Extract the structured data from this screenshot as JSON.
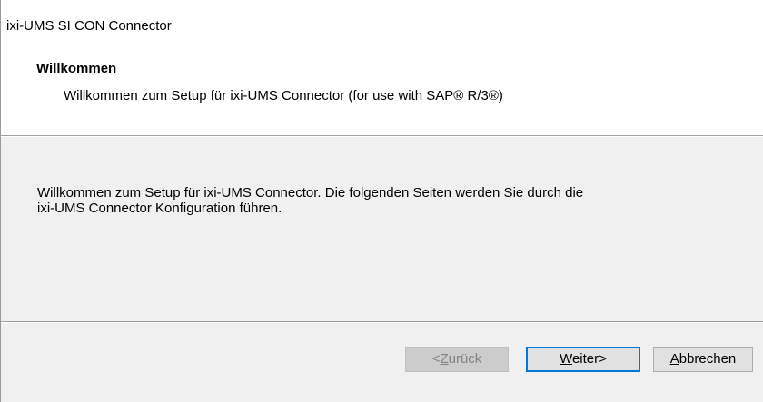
{
  "window": {
    "title": "ixi-UMS SI CON Connector"
  },
  "header": {
    "title": "Willkommen",
    "subtitle": "Willkommen zum Setup für ixi-UMS Connector (for use with SAP® R/3®)"
  },
  "content": {
    "line1": "Willkommen zum Setup für ixi-UMS Connector. Die folgenden Seiten werden Sie durch die",
    "line2": "ixi-UMS Connector Konfiguration führen."
  },
  "buttons": {
    "back": {
      "prefix": "<",
      "mnemonic": "Z",
      "rest": "urück",
      "enabled": false
    },
    "next": {
      "mnemonic": "W",
      "rest": "eiter>",
      "default": true
    },
    "cancel": {
      "mnemonic": "A",
      "rest": "bbrechen"
    }
  },
  "colors": {
    "header_bg": "#ffffff",
    "body_bg": "#f0f0f0",
    "default_button_border": "#0078d7",
    "disabled_text": "#838383"
  }
}
